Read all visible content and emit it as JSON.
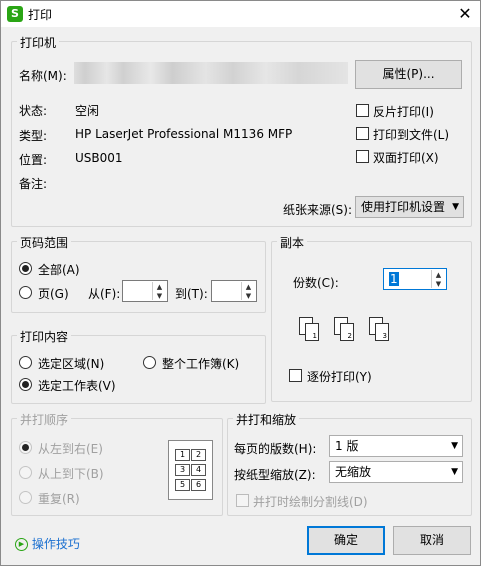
{
  "window": {
    "title": "打印",
    "app_icon_letter": "S"
  },
  "printer": {
    "group_title": "打印机",
    "name_label": "名称(M):",
    "properties_button": "属性(P)...",
    "status_label": "状态:",
    "status_value": "空闲",
    "type_label": "类型:",
    "type_value": "HP LaserJet Professional M1136 MFP",
    "location_label": "位置:",
    "location_value": "USB001",
    "comment_label": "备注:",
    "options": {
      "reverse": "反片打印(I)",
      "to_file": "打印到文件(L)",
      "duplex": "双面打印(X)"
    },
    "paper_source_label": "纸张来源(S):",
    "paper_source_value": "使用打印机设置"
  },
  "page_range": {
    "group_title": "页码范围",
    "all": "全部(A)",
    "pages": "页(G)",
    "from_label": "从(F):",
    "to_label": "到(T):"
  },
  "copies": {
    "group_title": "副本",
    "count_label": "份数(C):",
    "count_value": "1",
    "collate_label": "逐份打印(Y)",
    "page_icons": [
      "1",
      "1",
      "2",
      "2",
      "3",
      "3"
    ]
  },
  "print_content": {
    "group_title": "打印内容",
    "selection": "选定区域(N)",
    "workbook": "整个工作簿(K)",
    "worksheet": "选定工作表(V)"
  },
  "print_order": {
    "group_title": "并打顺序",
    "left_to_right": "从左到右(E)",
    "top_to_bottom": "从上到下(B)",
    "repeat": "重复(R)",
    "grid_numbers": [
      "1",
      "2",
      "3",
      "4",
      "5",
      "6"
    ]
  },
  "zoom": {
    "group_title": "并打和缩放",
    "pages_per_sheet_label": "每页的版数(H):",
    "pages_per_sheet_value": "1 版",
    "scale_label": "按纸型缩放(Z):",
    "scale_value": "无缩放",
    "draw_lines_label": "并打时绘制分割线(D)"
  },
  "footer": {
    "tips_link": "操作技巧",
    "ok_button": "确定",
    "cancel_button": "取消"
  }
}
